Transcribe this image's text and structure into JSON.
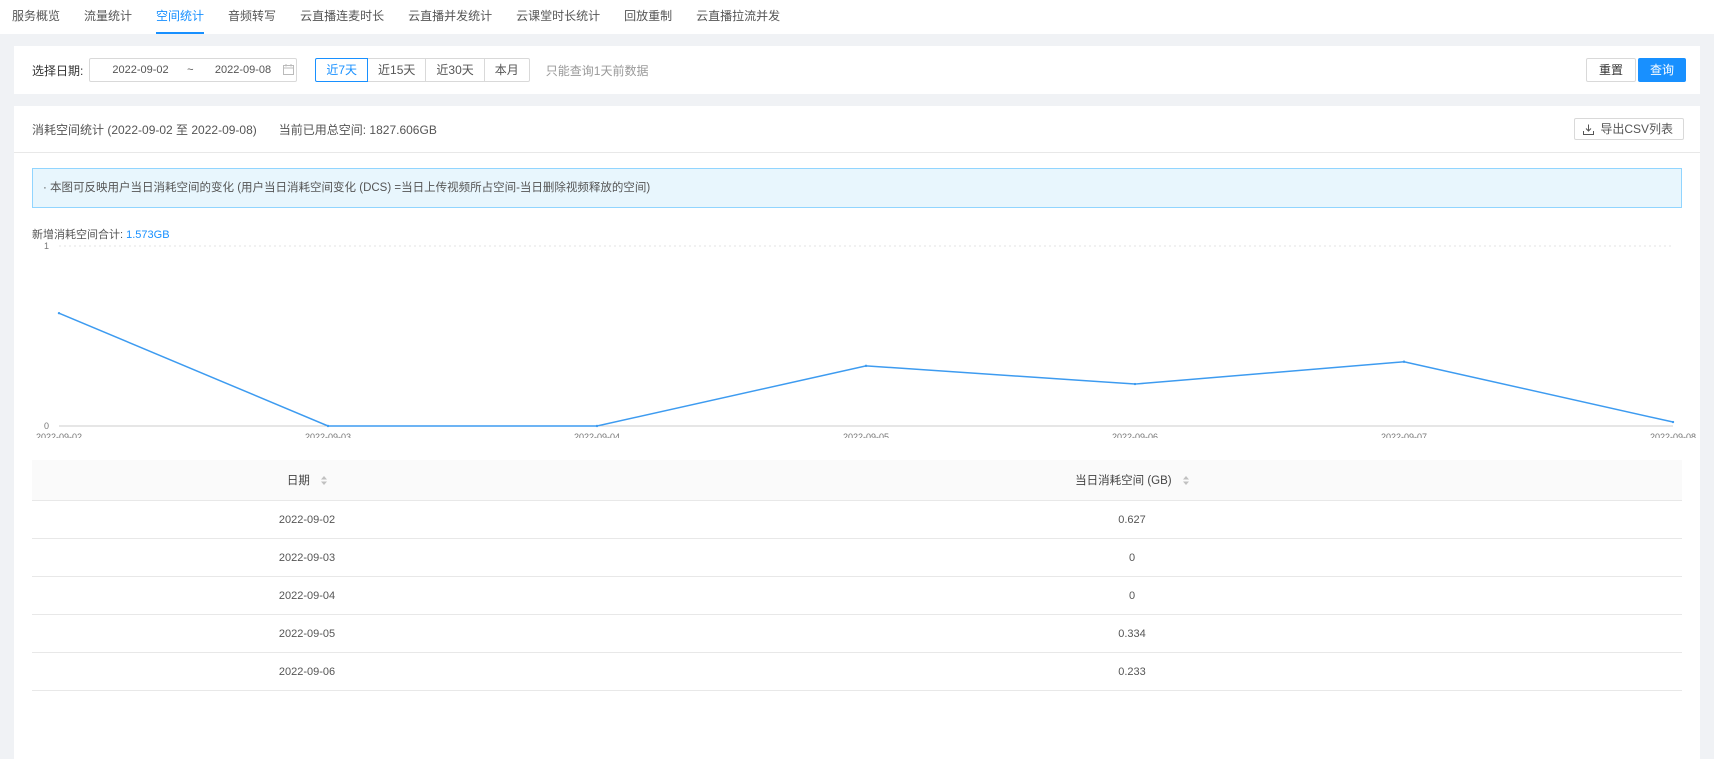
{
  "tabs": [
    "服务概览",
    "流量统计",
    "空间统计",
    "音频转写",
    "云直播连麦时长",
    "云直播并发统计",
    "云课堂时长统计",
    "回放重制",
    "云直播拉流并发"
  ],
  "active_tab": 2,
  "filter": {
    "date_label": "选择日期:",
    "start_date": "2022-09-02",
    "separator": "~",
    "end_date": "2022-09-08",
    "quick_ranges": [
      "近7天",
      "近15天",
      "近30天",
      "本月"
    ],
    "active_range": 0,
    "hint": "只能查询1天前数据",
    "reset_label": "重置",
    "query_label": "查询"
  },
  "summary": {
    "title": "消耗空间统计 (2022-09-02 至 2022-09-08)",
    "used_total": "当前已用总空间: 1827.606GB",
    "export_label": "导出CSV列表",
    "notice": "· 本图可反映用户当日消耗空间的变化 (用户当日消耗空间变化 (DCS) =当日上传视频所占空间-当日删除视频释放的空间)",
    "total_label": "新增消耗空间合计:",
    "total_value": "1.573GB"
  },
  "chart_data": {
    "type": "line",
    "x": [
      "2022-09-02",
      "2022-09-03",
      "2022-09-04",
      "2022-09-05",
      "2022-09-06",
      "2022-09-07",
      "2022-09-08"
    ],
    "series": [
      {
        "values": [
          0.627,
          0,
          0,
          0.334,
          0.233,
          0.357,
          0.022
        ]
      }
    ],
    "ylim": [
      0,
      1
    ],
    "yticks": [
      "0",
      "1"
    ],
    "grid": true,
    "color": "#3d9bf0"
  },
  "table": {
    "headers": [
      "日期",
      "当日消耗空间 (GB)"
    ],
    "rows": [
      [
        "2022-09-02",
        "0.627"
      ],
      [
        "2022-09-03",
        "0"
      ],
      [
        "2022-09-04",
        "0"
      ],
      [
        "2022-09-05",
        "0.334"
      ],
      [
        "2022-09-06",
        "0.233"
      ]
    ]
  }
}
